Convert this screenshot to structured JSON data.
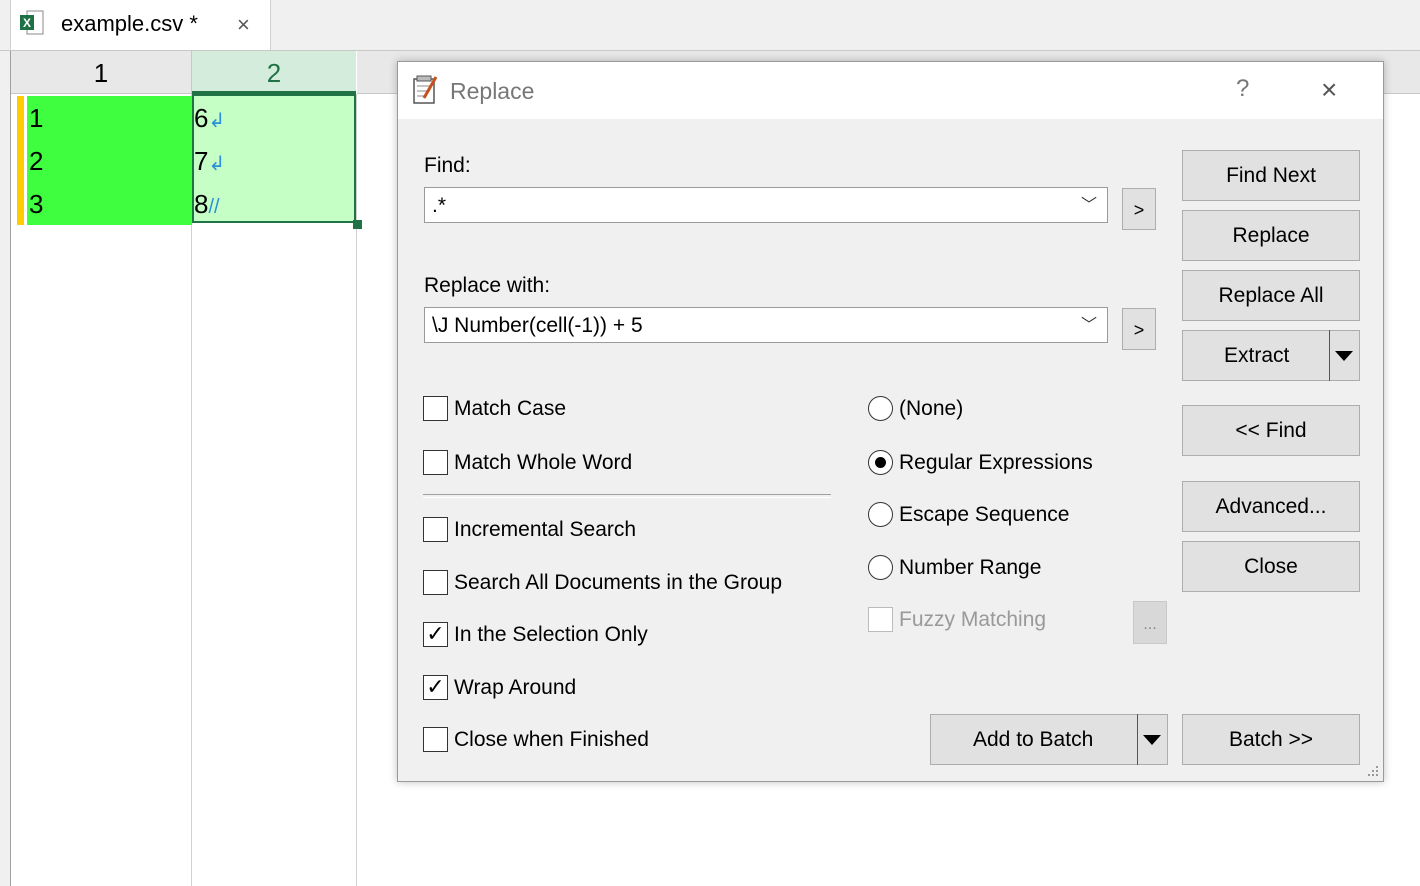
{
  "tab": {
    "filename": "example.csv",
    "modified": "*",
    "close": "×"
  },
  "sheet": {
    "col_headers": [
      "1",
      "2"
    ],
    "col1": [
      "1",
      "2",
      "3"
    ],
    "col2": [
      "6",
      "7",
      "8"
    ]
  },
  "dialog": {
    "title": "Replace",
    "help": "?",
    "close": "×",
    "find_label": "Find:",
    "find_value": ".*",
    "replace_label": "Replace with:",
    "replace_value": "\\J Number(cell(-1)) + 5",
    "expand_btn": ">",
    "buttons": {
      "find_next": "Find Next",
      "replace": "Replace",
      "replace_all": "Replace All",
      "extract": "Extract",
      "find_toggle": "<< Find",
      "advanced": "Advanced...",
      "close": "Close",
      "add_to_batch": "Add to Batch",
      "batch": "Batch >>",
      "fuzzy_options": "..."
    },
    "checkboxes": {
      "match_case": {
        "label": "Match Case",
        "checked": false
      },
      "match_whole_word": {
        "label": "Match Whole Word",
        "checked": false
      },
      "incremental": {
        "label": "Incremental Search",
        "checked": false
      },
      "search_all": {
        "label": "Search All Documents in the Group",
        "checked": false
      },
      "selection_only": {
        "label": "In the Selection Only",
        "checked": true
      },
      "wrap_around": {
        "label": "Wrap Around",
        "checked": true
      },
      "close_finished": {
        "label": "Close when Finished",
        "checked": false
      },
      "fuzzy": {
        "label": "Fuzzy Matching",
        "checked": false,
        "disabled": true
      }
    },
    "radios": {
      "none": {
        "label": "(None)",
        "selected": false
      },
      "regex": {
        "label": "Regular Expressions",
        "selected": true
      },
      "escape": {
        "label": "Escape Sequence",
        "selected": false
      },
      "range": {
        "label": "Number Range",
        "selected": false
      }
    },
    "check_glyph": "✓"
  },
  "colors": {
    "selection_green": "#3ffe3f",
    "cell_light_green": "#c6ffc6",
    "excel_green": "#217346",
    "bookmark_yellow": "#ffcc00"
  }
}
